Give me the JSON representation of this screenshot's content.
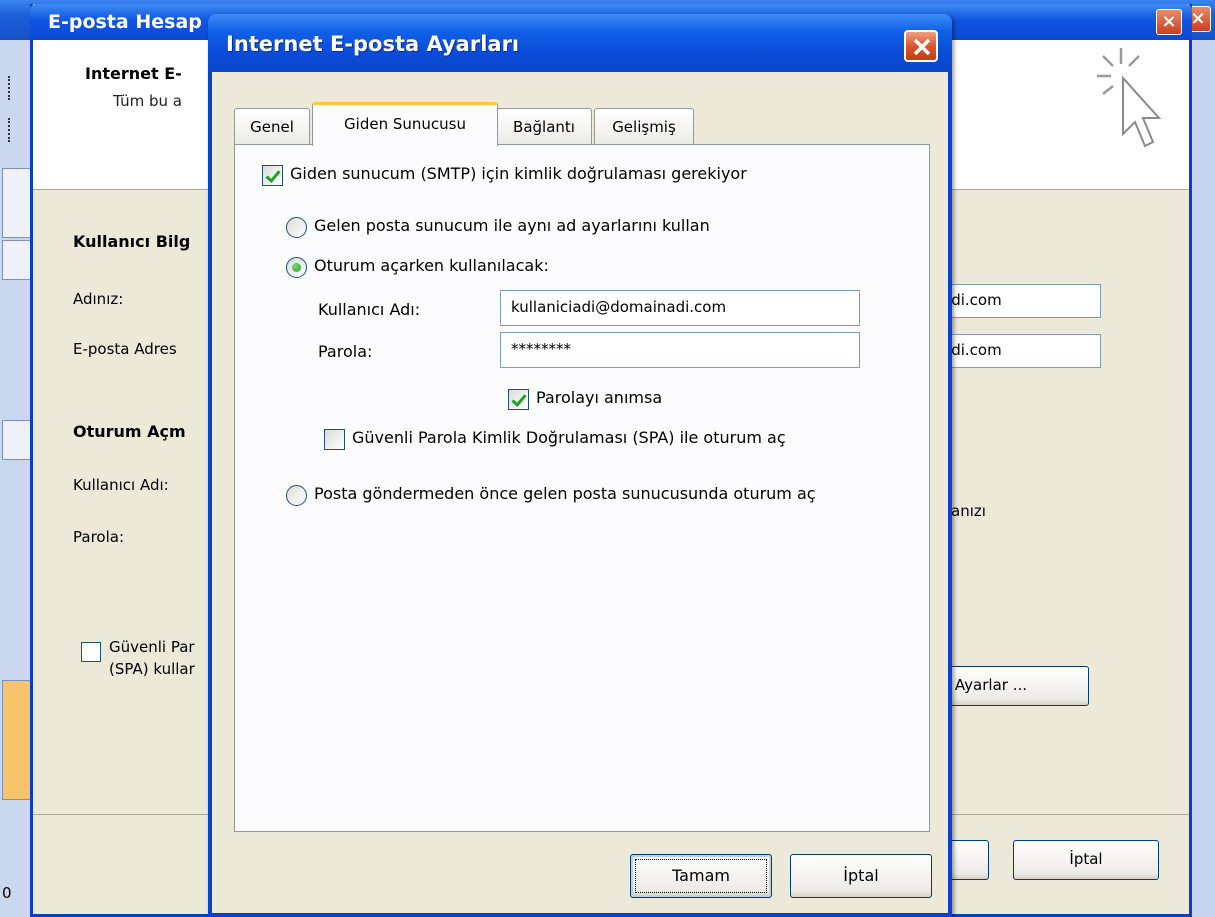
{
  "main_window": {
    "status_text": "0"
  },
  "account_dialog": {
    "title": "E-posta Hesap",
    "header_title": "Internet E-",
    "header_subtitle": "Tüm bu a",
    "section_user": "Kullanıcı Bilg",
    "label_name": "Adınız:",
    "label_email": "E-posta Adres",
    "value_name_suffix": "adi.com",
    "value_email_suffix": "adi.com",
    "section_logon": "Oturum Açm",
    "label_username": "Kullanıcı Adı:",
    "label_password": "Parola:",
    "spa_text_line1": "Güvenli Par",
    "spa_text_line2": "(SPA) kullar",
    "right_text_1": "anızı",
    "more_settings_button": "r Ayarlar ...",
    "cancel_button": "İptal"
  },
  "dialog": {
    "title": "Internet E-posta Ayarları",
    "tabs": [
      {
        "label": "Genel",
        "active": false
      },
      {
        "label": "Giden Sunucusu",
        "active": true
      },
      {
        "label": "Bağlantı",
        "active": false
      },
      {
        "label": "Gelişmiş",
        "active": false
      }
    ],
    "smtp_auth": {
      "label": "Giden sunucum (SMTP) için kimlik doğrulaması gerekiyor",
      "checked": true
    },
    "radio_same_settings": {
      "label": "Gelen posta sunucum ile aynı ad ayarlarını kullan",
      "selected": false
    },
    "radio_logon_using": {
      "label": "Oturum açarken kullanılacak:",
      "selected": true
    },
    "username": {
      "label": "Kullanıcı Adı:",
      "value": "kullaniciadi@domainadi.com"
    },
    "password": {
      "label": "Parola:",
      "value": "********"
    },
    "remember_password": {
      "label": "Parolayı anımsa",
      "checked": true
    },
    "spa": {
      "label": "Güvenli Parola Kimlik Doğrulaması (SPA) ile oturum aç",
      "checked": false
    },
    "radio_logon_before": {
      "label": "Posta göndermeden önce gelen posta sunucusunda oturum aç",
      "selected": false
    },
    "ok_button": "Tamam",
    "cancel_button": "İptal"
  }
}
